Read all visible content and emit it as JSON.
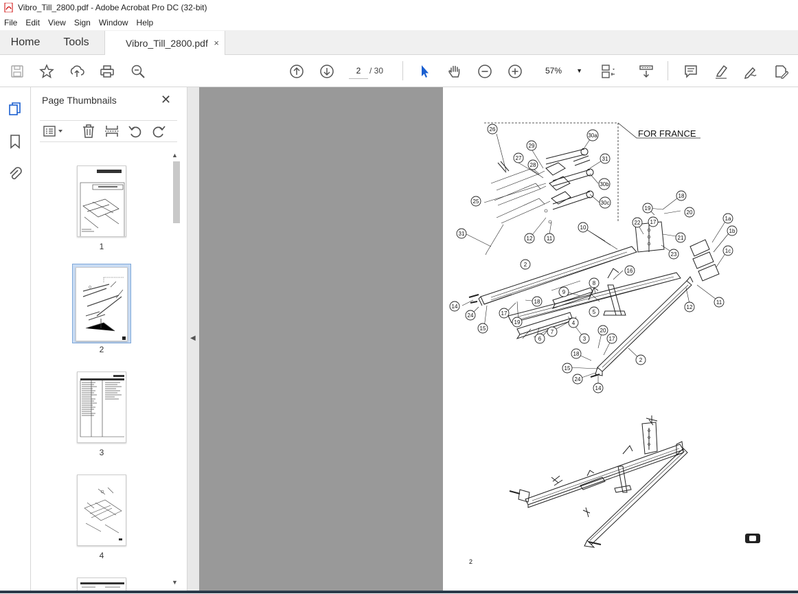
{
  "window": {
    "title": "Vibro_Till_2800.pdf - Adobe Acrobat Pro DC (32-bit)"
  },
  "menu": [
    "File",
    "Edit",
    "View",
    "Sign",
    "Window",
    "Help"
  ],
  "tabs": {
    "home": "Home",
    "tools": "Tools",
    "document": "Vibro_Till_2800.pdf",
    "close": "×"
  },
  "toolbar": {
    "current_page": "2",
    "total_pages": "/ 30",
    "zoom": "57%",
    "icons": [
      "save-icon",
      "star-icon",
      "upload-icon",
      "print-icon",
      "zoom-search-icon",
      "arrow-up-icon",
      "arrow-down-icon",
      "select-cursor-icon",
      "hand-icon",
      "zoom-out-icon",
      "zoom-in-icon",
      "fit-page-icon",
      "scroll-mode-icon",
      "comment-icon",
      "highlight-icon",
      "sign-icon",
      "edit-pdf-icon"
    ]
  },
  "thumbnails_panel": {
    "title": "Page Thumbnails",
    "close": "✕",
    "pages": [
      {
        "number": "1",
        "selected": false
      },
      {
        "number": "2",
        "selected": true
      },
      {
        "number": "3",
        "selected": false
      },
      {
        "number": "4",
        "selected": false
      }
    ]
  },
  "document": {
    "note": "FOR FRANCE",
    "page_number": "2",
    "callouts": [
      "26",
      "29",
      "30a",
      "27",
      "28",
      "31",
      "30b",
      "25",
      "30c",
      "12",
      "11",
      "31",
      "18",
      "19",
      "20",
      "17",
      "22",
      "1a",
      "10",
      "1b",
      "21",
      "23",
      "1c",
      "2",
      "16",
      "8",
      "9",
      "14",
      "24",
      "5",
      "18",
      "12",
      "11",
      "17",
      "19",
      "4",
      "7",
      "15",
      "6",
      "3",
      "20",
      "17",
      "18",
      "2",
      "15",
      "24",
      "14"
    ]
  },
  "colors": {
    "accent": "#d00000",
    "gray_area": "#999999",
    "selection": "#c9dcf4"
  }
}
